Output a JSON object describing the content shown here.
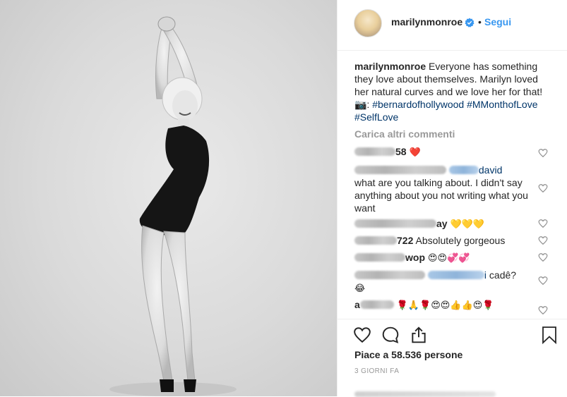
{
  "post": {
    "username": "marilynmonroe",
    "follow_label": "Segui",
    "separator": "•"
  },
  "caption": {
    "username": "marilynmonroe",
    "text": "Everyone has something they love about themselves. Marilyn loved her natural curves and we love her for that! 📷: ",
    "tags": [
      "#bernardofhollywood",
      "#MMonthofLove",
      "#SelfLove"
    ]
  },
  "load_more_label": "Carica altri commenti",
  "comments": [
    {
      "suffix": "58",
      "emoji": "❤️"
    },
    {
      "mention_suffix": "david",
      "text": "what are you talking about. I didn't say anything about you not writing what you want"
    },
    {
      "suffix": "ay",
      "emoji": "💛💛💛"
    },
    {
      "suffix": "722",
      "text": "Absolutely gorgeous"
    },
    {
      "suffix": "wop",
      "emoji": "😍😍💞💞"
    },
    {
      "mention_suffix": "i",
      "text": "cadê?",
      "emoji": "😂"
    },
    {
      "prefix": "a",
      "emoji": "🌹🙏🌹😍😍👍👍😍🌹"
    }
  ],
  "likes_label": "Piace a 58.536 persone",
  "time_label": "3 GIORNI FA",
  "colors": {
    "link_blue": "#3897f0",
    "tag_blue": "#003569",
    "text": "#262626",
    "muted": "#999999"
  },
  "icons": {
    "verified": "verified-badge-icon",
    "like": "heart-icon",
    "comment": "comment-bubble-icon",
    "share": "share-icon",
    "save": "bookmark-icon"
  }
}
